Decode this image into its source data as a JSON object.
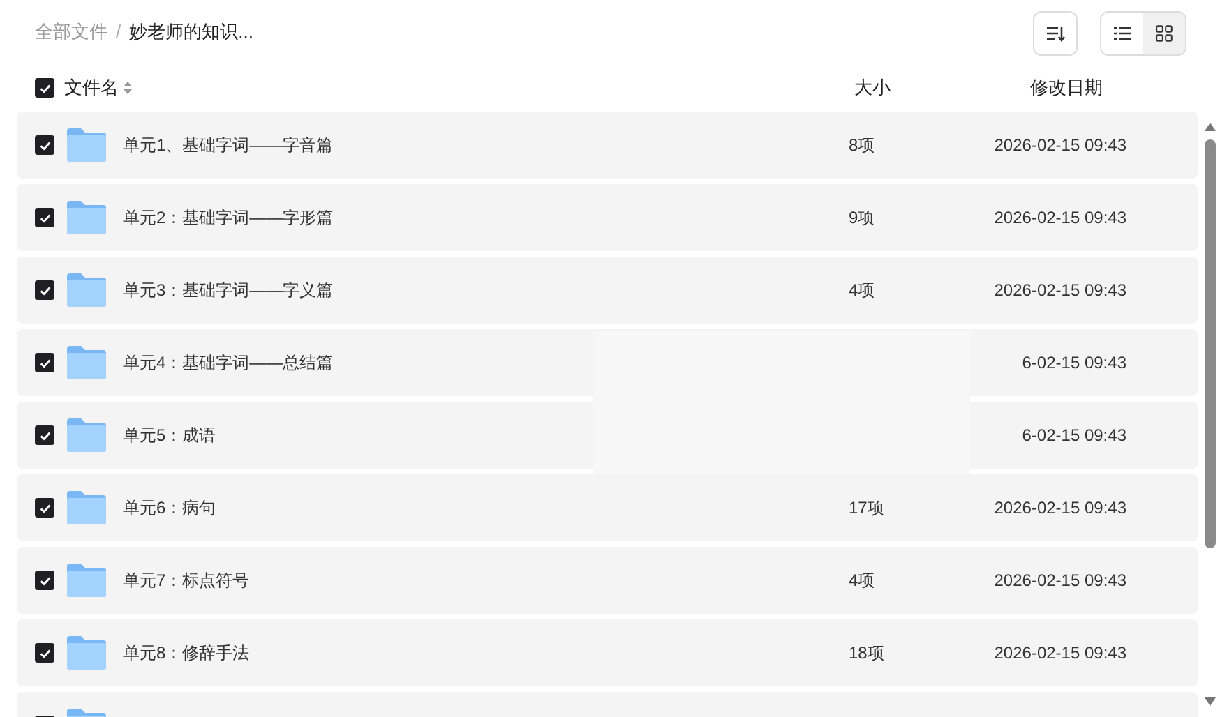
{
  "breadcrumb": [
    {
      "label": "全部文件",
      "current": false
    },
    {
      "label": "妙老师的知识...",
      "current": true
    }
  ],
  "breadcrumb_separator": "/",
  "view_toggle": [
    {
      "kind": "list",
      "selected": true
    },
    {
      "kind": "grid",
      "selected": false
    }
  ],
  "header": {
    "select_all_checked": true,
    "name": "文件名",
    "size": "大小",
    "modified": "修改日期"
  },
  "rows": [
    {
      "checked": true,
      "name": "单元1、基础字词——字音篇",
      "size": "8项",
      "modified": "2026-02-15 09:43"
    },
    {
      "checked": true,
      "name": "单元2：基础字词——字形篇",
      "size": "9项",
      "modified": "2026-02-15 09:43"
    },
    {
      "checked": true,
      "name": "单元3：基础字词——字义篇",
      "size": "4项",
      "modified": "2026-02-15 09:43"
    },
    {
      "checked": true,
      "name": "单元4：基础字词——总结篇",
      "modified": "6-02-15 09:43"
    },
    {
      "checked": true,
      "name": "单元5：成语",
      "modified": "6-02-15 09:43"
    },
    {
      "checked": true,
      "name": "单元6：病句",
      "size": "17项",
      "modified": "2026-02-15 09:43"
    },
    {
      "checked": true,
      "name": "单元7：标点符号",
      "size": "4项",
      "modified": "2026-02-15 09:43"
    },
    {
      "checked": true,
      "name": "单元8：修辞手法",
      "size": "18项",
      "modified": "2026-02-15 09:43"
    },
    {
      "checked": true
    }
  ]
}
